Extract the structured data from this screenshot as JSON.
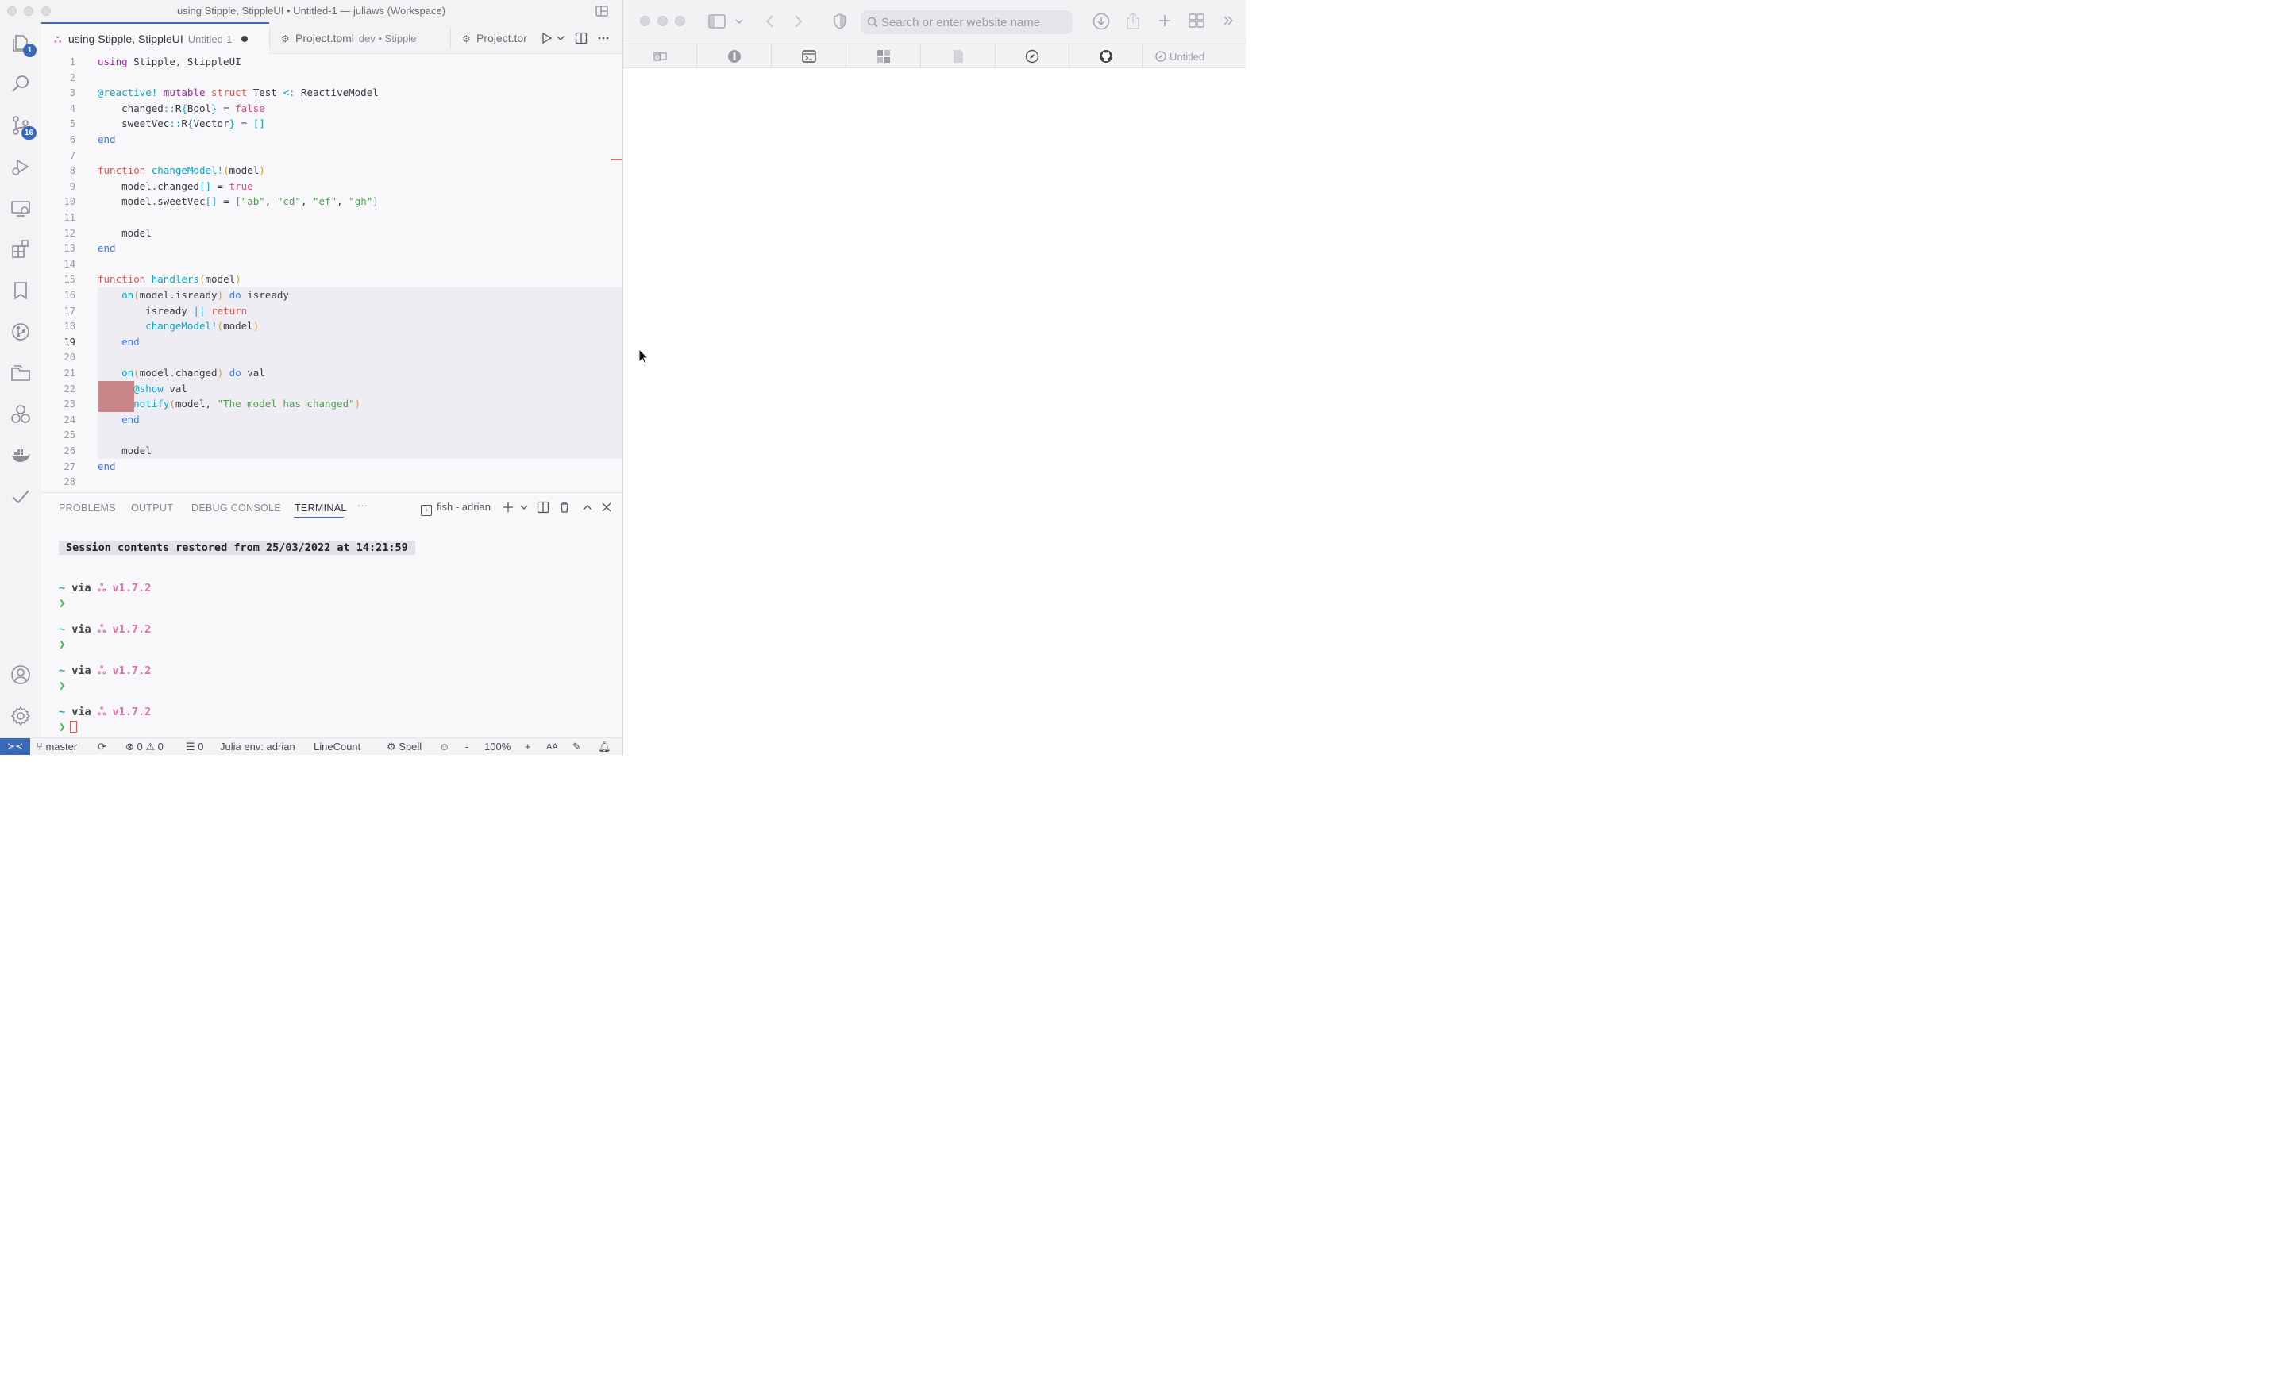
{
  "vscode": {
    "window_title": "using Stipple, StippleUI • Untitled-1 — juliaws (Workspace)",
    "activity_bar": {
      "explorer_badge": "1",
      "scm_badge": "16"
    },
    "tabs": [
      {
        "label": "using Stipple, StippleUI",
        "description": "Untitled-1",
        "dirty": true
      },
      {
        "label": "Project.toml",
        "description": "dev • Stipple"
      },
      {
        "label": "Project.tor",
        "description": ""
      }
    ],
    "editor": {
      "current_line": 19,
      "line_numbers": [
        "1",
        "2",
        "3",
        "4",
        "5",
        "6",
        "7",
        "8",
        "9",
        "10",
        "11",
        "12",
        "13",
        "14",
        "15",
        "16",
        "17",
        "18",
        "19",
        "20",
        "21",
        "22",
        "23",
        "24",
        "25",
        "26",
        "27",
        "28"
      ],
      "lines": [
        "using Stipple, StippleUI",
        "",
        "@reactive! mutable struct Test <: ReactiveModel",
        "    changed::R{Bool} = false",
        "    sweetVec::R{Vector} = []",
        "end",
        "",
        "function changeModel!(model)",
        "    model.changed[] = true",
        "    model.sweetVec[] = [\"ab\", \"cd\", \"ef\", \"gh\"]",
        "",
        "    model",
        "end",
        "",
        "function handlers(model)",
        "    on(model.isready) do isready",
        "        isready || return",
        "        changeModel!(model)",
        "    end",
        "",
        "    on(model.changed) do val",
        "      @show val",
        "      notify(model, \"The model has changed\")",
        "    end",
        "",
        "    model",
        "end",
        ""
      ]
    },
    "panel": {
      "tabs": [
        "PROBLEMS",
        "OUTPUT",
        "DEBUG CONSOLE",
        "TERMINAL"
      ],
      "active_tab": "TERMINAL",
      "more": "···",
      "terminal_name": "fish - adrian",
      "terminal": {
        "session_message": "Session contents restored from 25/03/2022 at 14:21:59",
        "prompt_tilde": "~",
        "prompt_via": "via",
        "prompt_julia_symbol": "ஃ",
        "prompt_version": "v1.7.2",
        "prompt_arrow": "❯",
        "prompt_count": 4
      }
    },
    "status_bar": {
      "branch": "master",
      "errors": "0",
      "warnings": "0",
      "info": "0",
      "julia_env": "Julia env: adrian",
      "line_count": "LineCount",
      "spell": "Spell",
      "zoom_minus": "-",
      "zoom": "100%",
      "zoom_plus": "+"
    }
  },
  "browser": {
    "search_placeholder": "Search or enter website name",
    "favorites_untitled": "Untitled"
  },
  "colors": {
    "accent": "#3a69b7",
    "diff_removed": "#c8858a",
    "julia_version": "#e86ea8"
  }
}
